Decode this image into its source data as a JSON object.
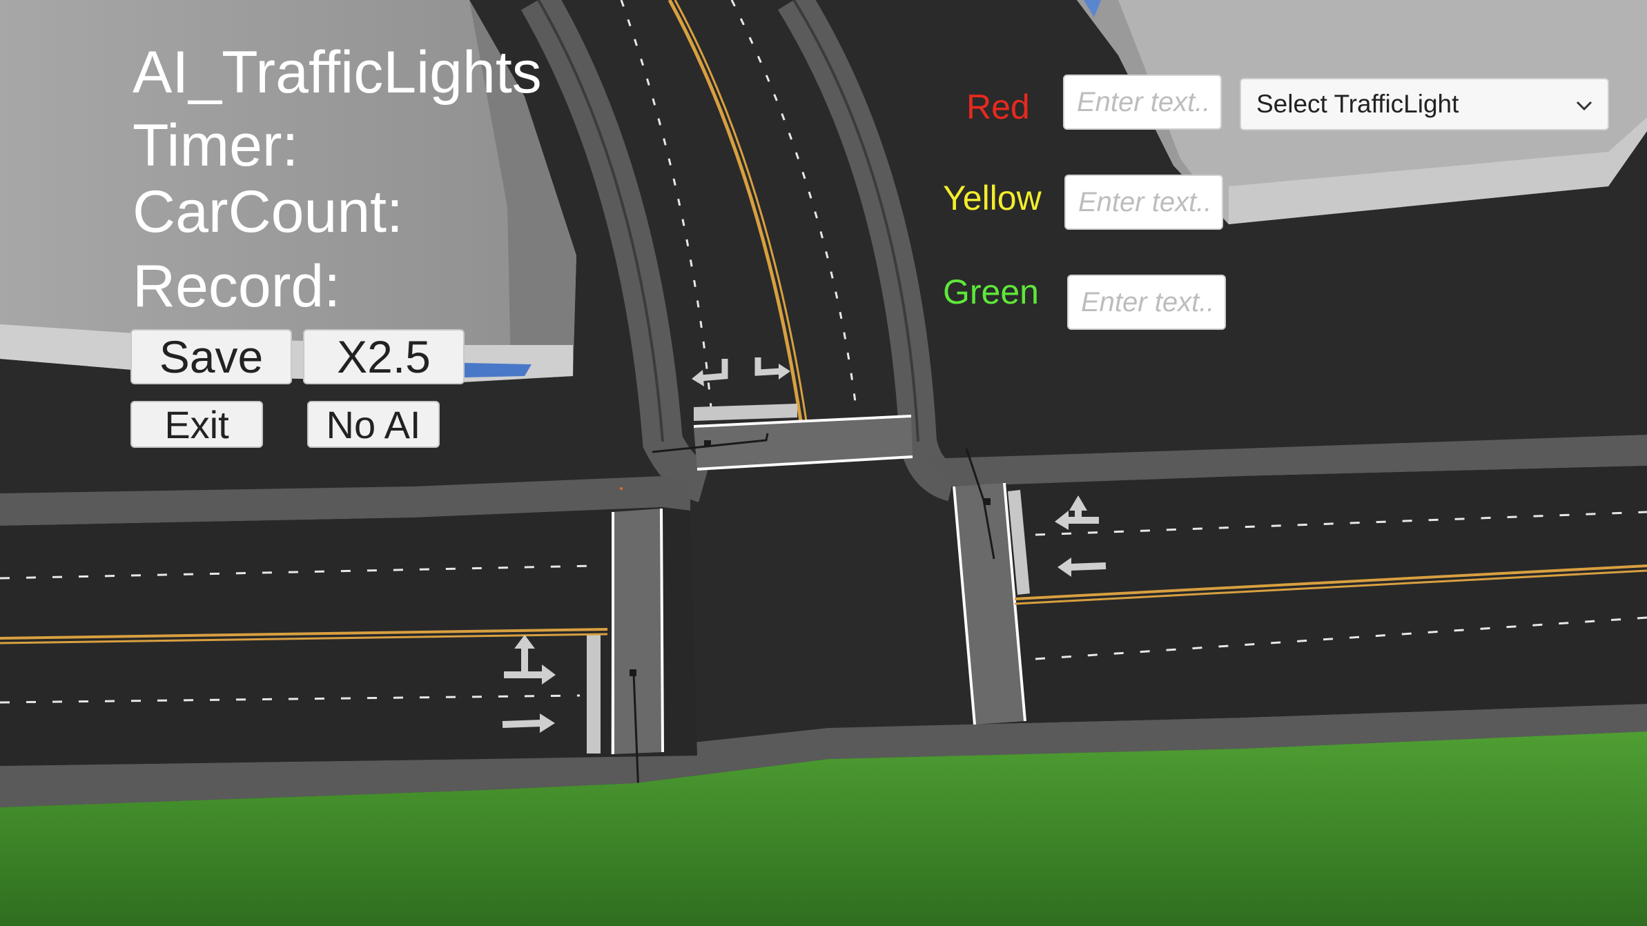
{
  "hud": {
    "title": "AI_TrafficLights",
    "timer_label": "Timer:",
    "carcount_label": "CarCount:",
    "record_label": "Record:",
    "buttons": {
      "save": "Save",
      "speed": "X2.5",
      "exit": "Exit",
      "no_ai": "No AI"
    }
  },
  "lights": {
    "red": {
      "label": "Red",
      "placeholder": "Enter text...",
      "color": "#e8291e"
    },
    "yellow": {
      "label": "Yellow",
      "placeholder": "Enter text...",
      "color": "#f3ee2c"
    },
    "green": {
      "label": "Green",
      "placeholder": "Enter text...",
      "color": "#5ee83a"
    }
  },
  "traffic_light_select": {
    "value": "Select TrafficLight"
  },
  "scene": {
    "colors": {
      "road": "#2c2c2c",
      "curb": "#5a5a5a",
      "grass": "#4a9a30",
      "building": "#a9a9a9",
      "center_line": "#d9a040",
      "lane_marking": "#e8e8e8"
    },
    "icons": [
      "turn-left-arrow-icon",
      "turn-right-arrow-icon",
      "straight-left-arrow-icon",
      "left-arrow-icon",
      "straight-right-arrow-icon",
      "right-arrow-icon"
    ]
  }
}
